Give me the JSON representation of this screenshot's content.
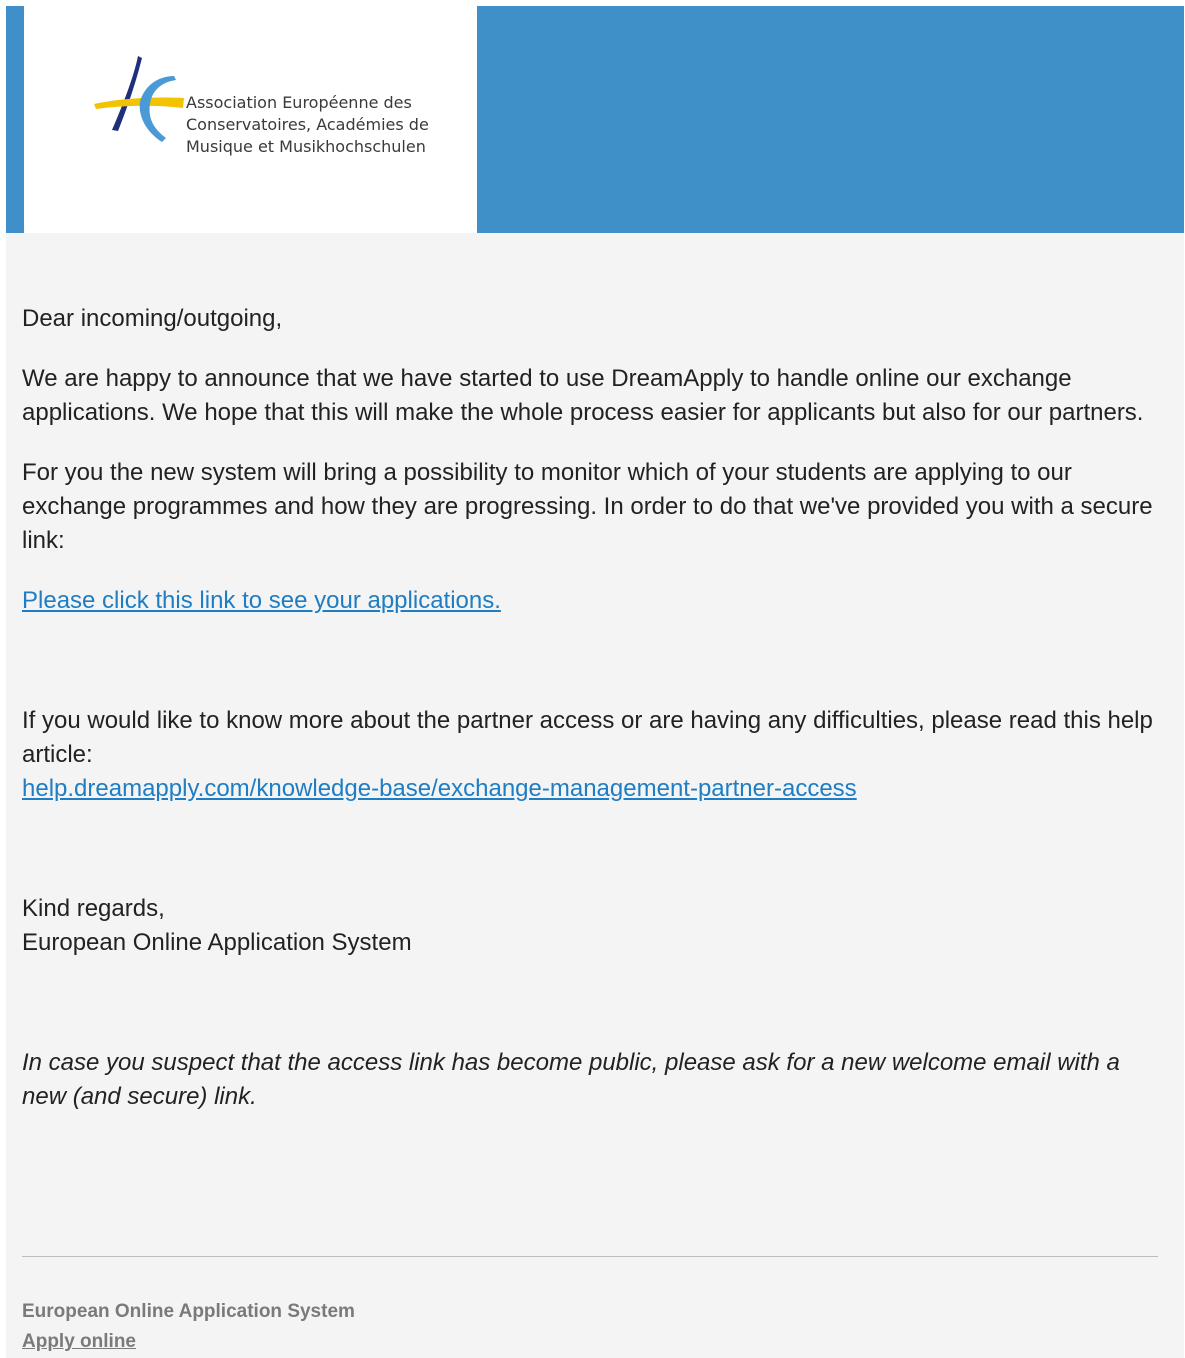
{
  "header": {
    "brand_color": "#3f8fc8",
    "logo": {
      "icon": "aec-logo-icon",
      "line1": "Association Européenne des",
      "line2": "Conservatoires, Académies de",
      "line3": "Musique et Musikhochschulen"
    }
  },
  "body": {
    "greeting": "Dear incoming/outgoing,",
    "paragraph1": "We are happy to announce that we have started to use DreamApply to handle online our exchange applications. We hope that this will make the whole process easier for applicants but also for our partners.",
    "paragraph2": "For you the new system will bring a possibility to monitor which of your students are applying to our exchange programmes and how they are progressing. In order to do that we've provided you with a secure link:",
    "applications_link": "Please click this link to see your applications.",
    "help_intro": "If you would like to know more about the partner access or are having any difficulties, please read this help article:",
    "help_link": "help.dreamapply.com/knowledge-base/exchange-management-partner-access",
    "regards": "Kind regards,",
    "signature": "European Online Application System",
    "security_note": "In case you suspect that the access link has become public, please ask for a new welcome email with a new (and secure) link."
  },
  "footer": {
    "name": "European Online Application System",
    "apply_link": "Apply online"
  },
  "colors": {
    "link": "#1e7dc3",
    "background": "#f4f4f4"
  }
}
